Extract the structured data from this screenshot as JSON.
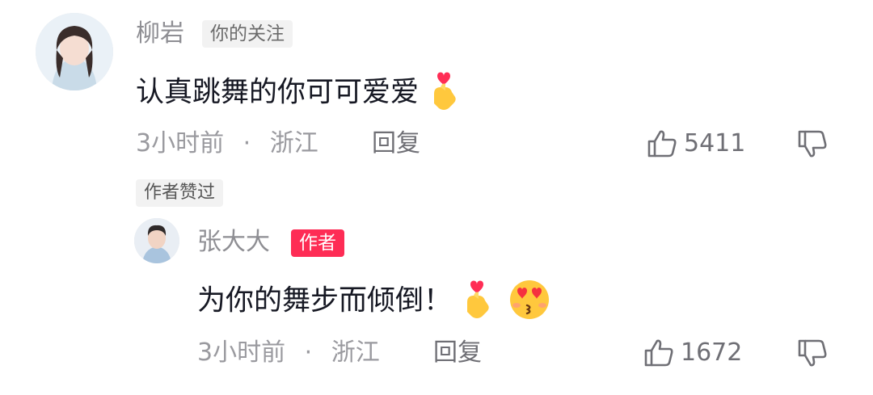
{
  "comment": {
    "username": "柳岩",
    "follow_tag": "你的关注",
    "text": "认真跳舞的你可可爱爱",
    "emojis": [
      "finger-heart-icon"
    ],
    "time": "3小时前",
    "separator": "·",
    "location": "浙江",
    "reply_label": "回复",
    "like_count": "5411",
    "author_liked_tag": "作者赞过"
  },
  "reply": {
    "username": "张大大",
    "author_tag": "作者",
    "text": "为你的舞步而倾倒！",
    "emojis": [
      "finger-heart-icon",
      "heart-eyes-kiss-icon"
    ],
    "time": "3小时前",
    "separator": "·",
    "location": "浙江",
    "reply_label": "回复",
    "like_count": "1672"
  },
  "colors": {
    "author_tag": "#fe2c55",
    "text": "#161823",
    "meta": "#9a9a9f"
  }
}
